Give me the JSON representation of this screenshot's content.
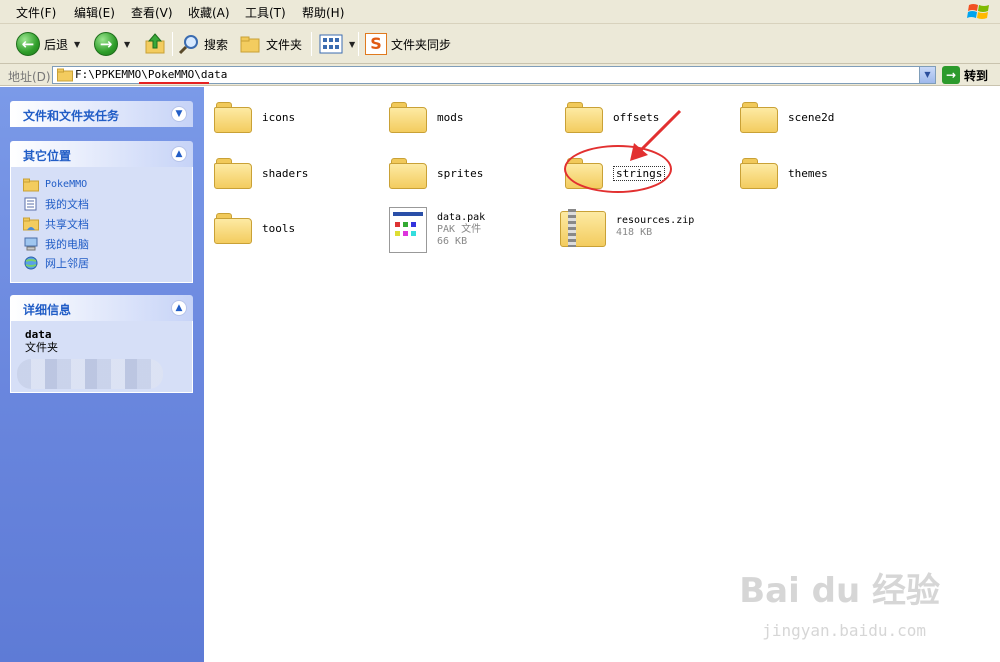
{
  "menu": [
    "文件(F)",
    "编辑(E)",
    "查看(V)",
    "收藏(A)",
    "工具(T)",
    "帮助(H)"
  ],
  "toolbar": {
    "back_label": "后退",
    "search_label": "搜索",
    "folders_label": "文件夹",
    "sync_label": "文件夹同步"
  },
  "address": {
    "label": "地址(D)",
    "path": "F:\\PPKEMMO\\PokeMMO\\data",
    "go_label": "转到"
  },
  "tasks_panel": {
    "title": "文件和文件夹任务"
  },
  "places_panel": {
    "title": "其它位置",
    "items": [
      "PokeMMO",
      "我的文档",
      "共享文档",
      "我的电脑",
      "网上邻居"
    ]
  },
  "details_panel": {
    "title": "详细信息",
    "name": "data",
    "type": "文件夹"
  },
  "files": {
    "icons": "icons",
    "mods": "mods",
    "offsets": "offsets",
    "scene2d": "scene2d",
    "shaders": "shaders",
    "sprites": "sprites",
    "strings": "strings",
    "themes": "themes",
    "tools": "tools",
    "data_pak": {
      "name": "data.pak",
      "type": "PAK 文件",
      "size": "66 KB"
    },
    "resources_zip": {
      "name": "resources.zip",
      "size": "418 KB"
    }
  },
  "watermark": {
    "brand": "Bai du 经验",
    "url": "jingyan.baidu.com"
  },
  "colors": {
    "accent": "#e23030",
    "panel_title": "#215dc6",
    "pane_bg": "#6a87de"
  }
}
